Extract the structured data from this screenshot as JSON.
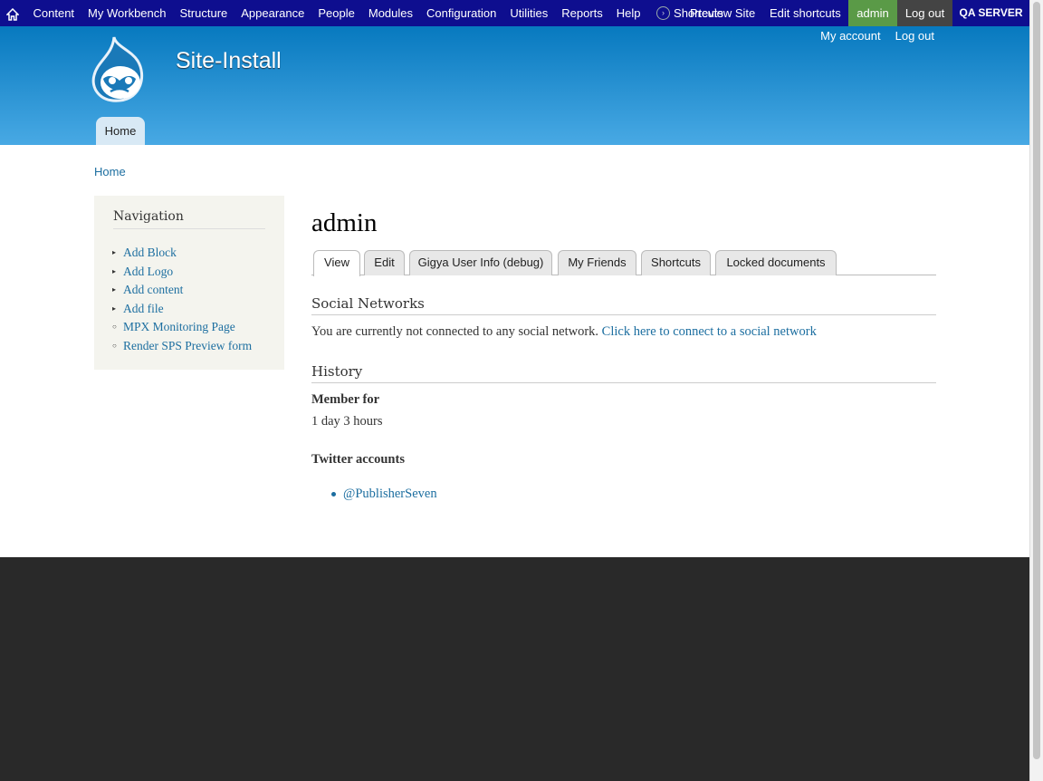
{
  "toolbar": {
    "items": [
      "Content",
      "My Workbench",
      "Structure",
      "Appearance",
      "People",
      "Modules",
      "Configuration",
      "Utilities",
      "Reports",
      "Help"
    ],
    "shortcuts": "Shortcuts",
    "preview": "Preview Site",
    "edit_shortcuts": "Edit shortcuts",
    "user": "admin",
    "logout": "Log out",
    "server": "QA SERVER"
  },
  "header": {
    "site_name": "Site-Install",
    "secondary": [
      "My account",
      "Log out"
    ],
    "main_tab": "Home"
  },
  "breadcrumb": "Home",
  "sidebar": {
    "title": "Navigation",
    "items": [
      {
        "label": "Add Block",
        "bullet": "▸"
      },
      {
        "label": "Add Logo",
        "bullet": "▸"
      },
      {
        "label": "Add content",
        "bullet": "▸"
      },
      {
        "label": "Add file",
        "bullet": "▸"
      },
      {
        "label": "MPX Monitoring Page",
        "bullet": "○"
      },
      {
        "label": "Render SPS Preview form",
        "bullet": "○"
      }
    ]
  },
  "main": {
    "title": "admin",
    "tabs": [
      "View",
      "Edit",
      "Gigya User Info (debug)",
      "My Friends",
      "Shortcuts",
      "Locked documents"
    ],
    "social_heading": "Social Networks",
    "social_text": "You are currently not connected to any social network.",
    "social_link": "Click here to connect to a social network",
    "history_heading": "History",
    "member_for_label": "Member for",
    "member_for_value": "1 day 3 hours",
    "twitter_heading": "Twitter accounts",
    "twitter_accounts": [
      "@PublisherSeven"
    ]
  },
  "colors": {
    "toolbar_bg": "#0e0e8f",
    "header_top": "#0779bf",
    "header_bottom": "#48a9e4",
    "link": "#1c6ea0",
    "user_badge": "#5a9a47",
    "footer": "#292929"
  }
}
